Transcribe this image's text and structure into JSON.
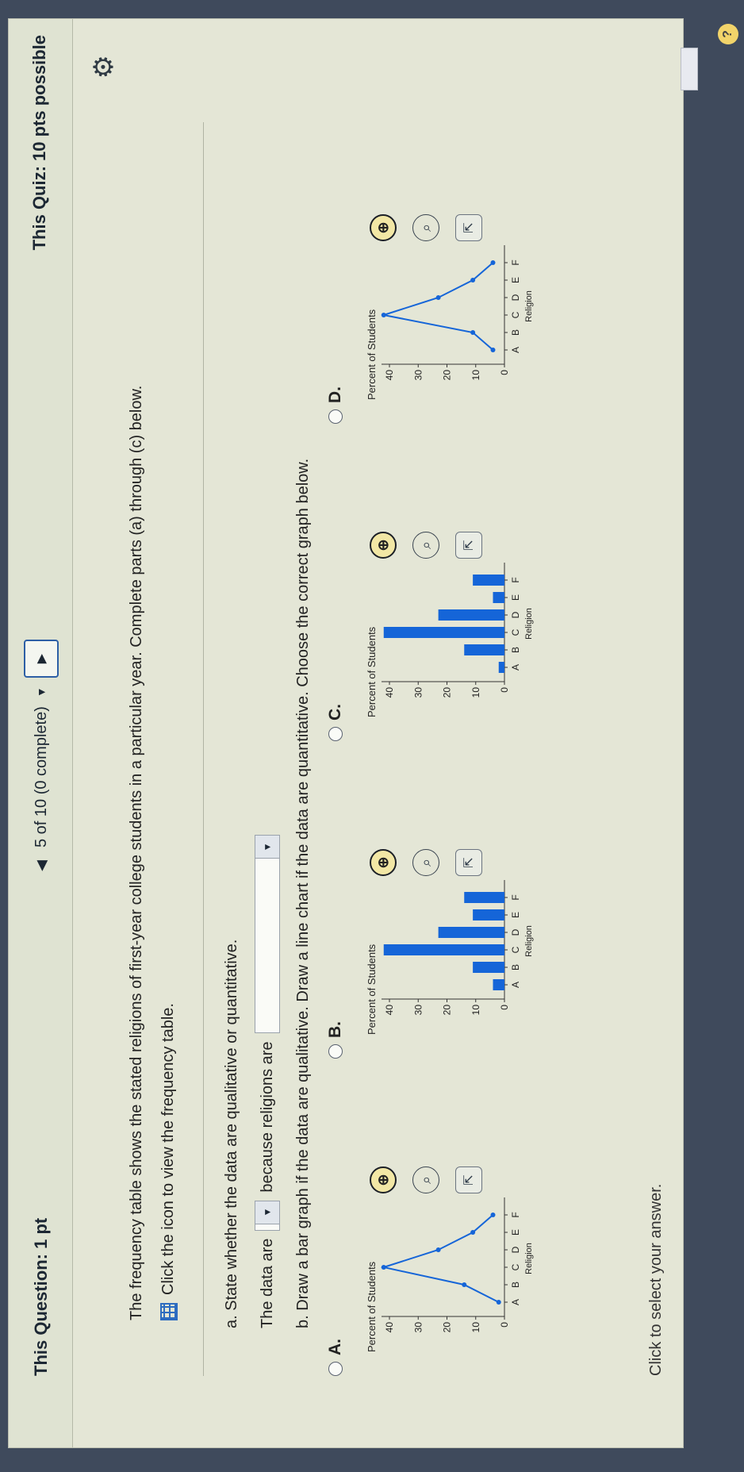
{
  "header": {
    "question_points": "This Question: 1 pt",
    "progress": "5 of 10 (0 complete)",
    "quiz_points": "This Quiz: 10 pts possible"
  },
  "question": {
    "intro": "The frequency table shows the stated religions of first-year college students in a particular year. Complete parts (a) through (c) below.",
    "table_link": "Click the icon to view the frequency table.",
    "part_a": "a. State whether the data are qualitative or quantitative.",
    "data_are": "The data are",
    "because": "because religions are",
    "part_b": "b. Draw a bar graph if the data are qualitative. Draw a line chart if the data are quantitative. Choose the correct graph below."
  },
  "options": [
    {
      "label": "A.",
      "kind": "line"
    },
    {
      "label": "B.",
      "kind": "bar"
    },
    {
      "label": "C.",
      "kind": "bar"
    },
    {
      "label": "D.",
      "kind": "line"
    }
  ],
  "icons": {
    "zoom_in": "zoom-in-icon",
    "zoom_out": "zoom-out-icon",
    "popout": "popout-icon",
    "settings": "gear-icon",
    "table": "grid-icon",
    "help": "help-icon"
  },
  "colors": {
    "series": "#1565d8",
    "accent": "#2d5fa5"
  },
  "chart_data": [
    {
      "type": "line",
      "categories": [
        "A",
        "B",
        "C",
        "D",
        "E",
        "F"
      ],
      "values": [
        2,
        14,
        42,
        23,
        11,
        4
      ],
      "ylabel": "Percent of Students",
      "xlabel": "Religion",
      "ylim": [
        0,
        40
      ],
      "yticks": [
        0,
        10,
        20,
        30,
        40
      ]
    },
    {
      "type": "bar",
      "categories": [
        "A",
        "B",
        "C",
        "D",
        "E",
        "F"
      ],
      "values": [
        4,
        11,
        42,
        23,
        11,
        14
      ],
      "ylabel": "Percent of Students",
      "xlabel": "Religion",
      "ylim": [
        0,
        40
      ],
      "yticks": [
        0,
        10,
        20,
        30,
        40
      ]
    },
    {
      "type": "bar",
      "categories": [
        "A",
        "B",
        "C",
        "D",
        "E",
        "F"
      ],
      "values": [
        2,
        14,
        42,
        23,
        4,
        11
      ],
      "ylabel": "Percent of Students",
      "xlabel": "Religion",
      "ylim": [
        0,
        40
      ],
      "yticks": [
        0,
        10,
        20,
        30,
        40
      ]
    },
    {
      "type": "line",
      "categories": [
        "A",
        "B",
        "C",
        "D",
        "E",
        "F"
      ],
      "values": [
        4,
        11,
        42,
        23,
        11,
        4
      ],
      "ylabel": "Percent of Students",
      "xlabel": "Religion",
      "ylim": [
        0,
        40
      ],
      "yticks": [
        0,
        10,
        20,
        30,
        40
      ]
    }
  ],
  "footer": "Click to select your answer."
}
